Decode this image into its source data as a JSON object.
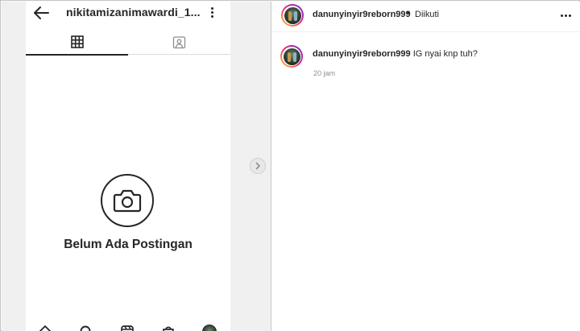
{
  "left": {
    "username": "nikitamizanimawardi_1...",
    "empty_state_text": "Belum Ada Postingan",
    "tabs": [
      {
        "icon": "grid-icon",
        "active": true
      },
      {
        "icon": "tagged-user-icon",
        "active": false
      }
    ],
    "bottom_nav": [
      "home-icon",
      "search-icon",
      "reels-icon",
      "shop-icon",
      "profile-avatar"
    ]
  },
  "right": {
    "header": {
      "username": "danunyinyir9reborn999",
      "separator": "•",
      "follow_status": "Diikuti"
    },
    "comment": {
      "username": "danunyinyir9reborn999",
      "text": " IG nyai knp tuh?",
      "time": "20 jam"
    }
  },
  "colors": {
    "text": "#262626",
    "muted": "#8e8e8e",
    "divider": "#dbdbdb",
    "story_ring": [
      "#f9ce34",
      "#ee2a7b",
      "#6228d7"
    ]
  }
}
